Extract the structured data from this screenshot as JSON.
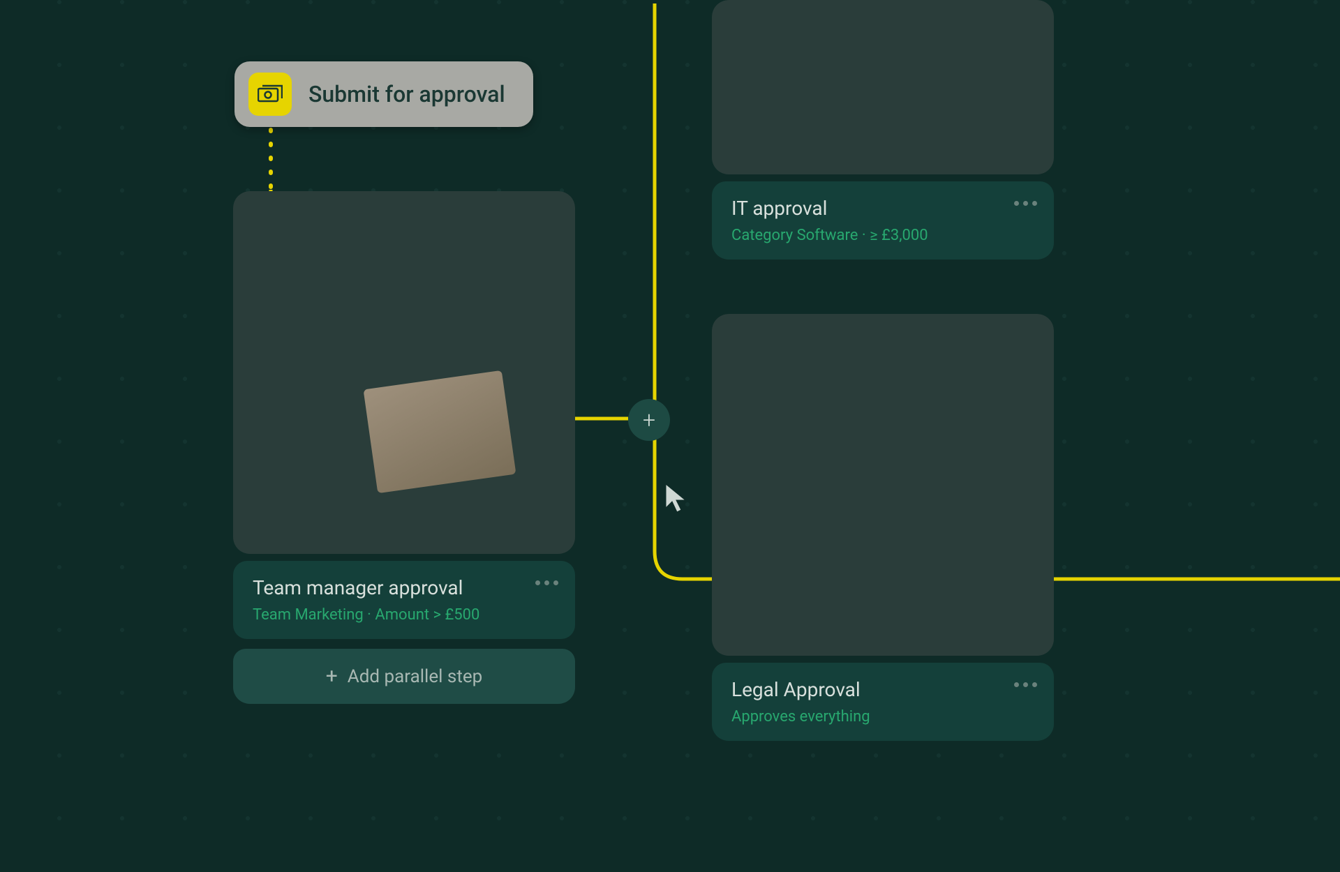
{
  "submit": {
    "label": "Submit for approval"
  },
  "steps": {
    "teamManager": {
      "title": "Team manager approval",
      "subtitle": "Team Marketing  ·  Amount  > £500"
    },
    "it": {
      "title": "IT approval",
      "subtitle": "Category Software  ·   ≥ £3,000"
    },
    "legal": {
      "title": "Legal Approval",
      "subtitle": "Approves everything"
    }
  },
  "addParallel": {
    "label": "Add parallel step"
  }
}
